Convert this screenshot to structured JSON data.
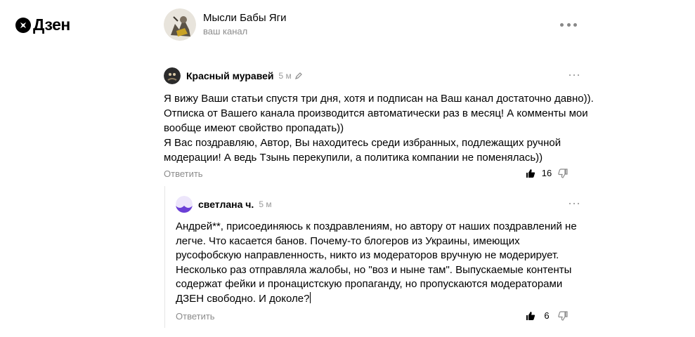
{
  "brand": {
    "name": "Дзен"
  },
  "channel": {
    "name": "Мысли Бабы Яги",
    "subtitle": "ваш канал"
  },
  "comments": [
    {
      "author": "Красный муравей",
      "time": "5 м",
      "text": "Я вижу Ваши статьи спустя три дня, хотя и подписан на Ваш канал достаточно давно)).\nОтписка от Вашего канала производится автоматически раз в месяц! А комменты мои\nвообще имеют свойство пропадать))\nЯ Вас поздравляю, Автор, Вы находитесь среди избранных, подлежащих ручной\nмодерации! А ведь Тзынь перекупили, а политика компании не поменялась))",
      "reply_label": "Ответить",
      "likes": "16"
    },
    {
      "author": "светлана ч.",
      "time": "5 м",
      "text": "Андрей**, присоединяюсь к поздравлениям, но автору от наших поздравлений не\nлегче. Что касается банов. Почему-то блогеров из Украины, имеющих\nрусофобскую направленность, никто из модераторов вручную не модерирует.\nНесколько раз отправляла жалобы, но \"воз и ныне там\". Выпускаемые контенты\nсодержат фейки и пронацистскую пропаганду, но пропускаются модераторами\nДЗЕН свободно. И доколе?",
      "reply_label": "Ответить",
      "likes": "6"
    }
  ],
  "icons": {
    "logo": "dzen-logo-icon",
    "more": "more-horizontal-icon",
    "like": "thumb-up-icon",
    "dislike": "thumb-down-icon",
    "edited": "pencil-icon"
  }
}
